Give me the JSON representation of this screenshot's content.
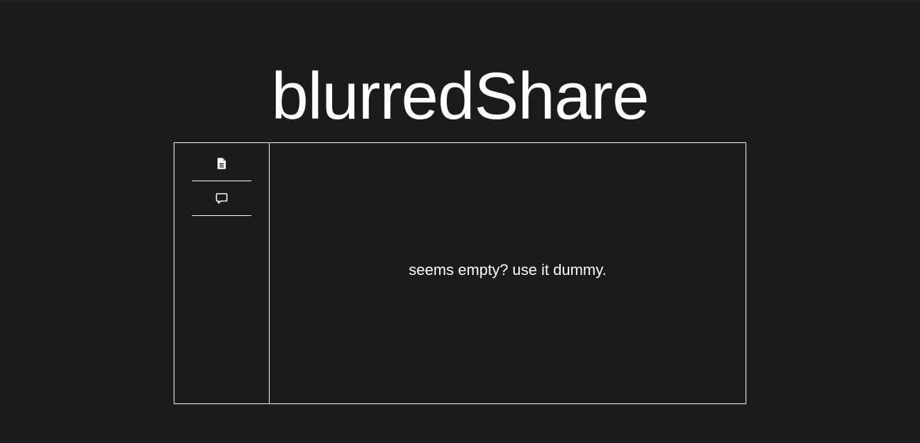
{
  "app": {
    "title": "blurredShare"
  },
  "sidebar": {
    "items": [
      {
        "icon": "file-icon"
      },
      {
        "icon": "chat-icon"
      }
    ]
  },
  "main": {
    "empty_message": "seems empty? use it dummy."
  },
  "colors": {
    "background": "#1b1b1b",
    "foreground": "#ffffff",
    "border": "#ffffff"
  }
}
